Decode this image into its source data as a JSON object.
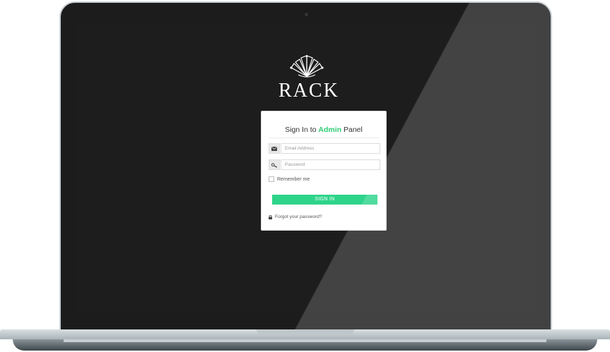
{
  "app": {
    "logo_text": "RACK",
    "logo_icon": "fan-crown-icon"
  },
  "login": {
    "title_prefix": "Sign In to ",
    "title_highlight": "Admin",
    "title_suffix": " Panel",
    "email": {
      "placeholder": "Email Address",
      "value": "",
      "icon": "envelope-icon"
    },
    "password": {
      "placeholder": "Password",
      "value": "",
      "icon": "key-icon"
    },
    "remember_label": "Remember me",
    "submit_label": "SIGN IN",
    "forgot_label": "Forgot your password?",
    "forgot_icon": "lock-icon"
  },
  "colors": {
    "accent": "#2ed48a",
    "screen_bg": "#1d1d1d",
    "card_bg": "#ffffff"
  }
}
